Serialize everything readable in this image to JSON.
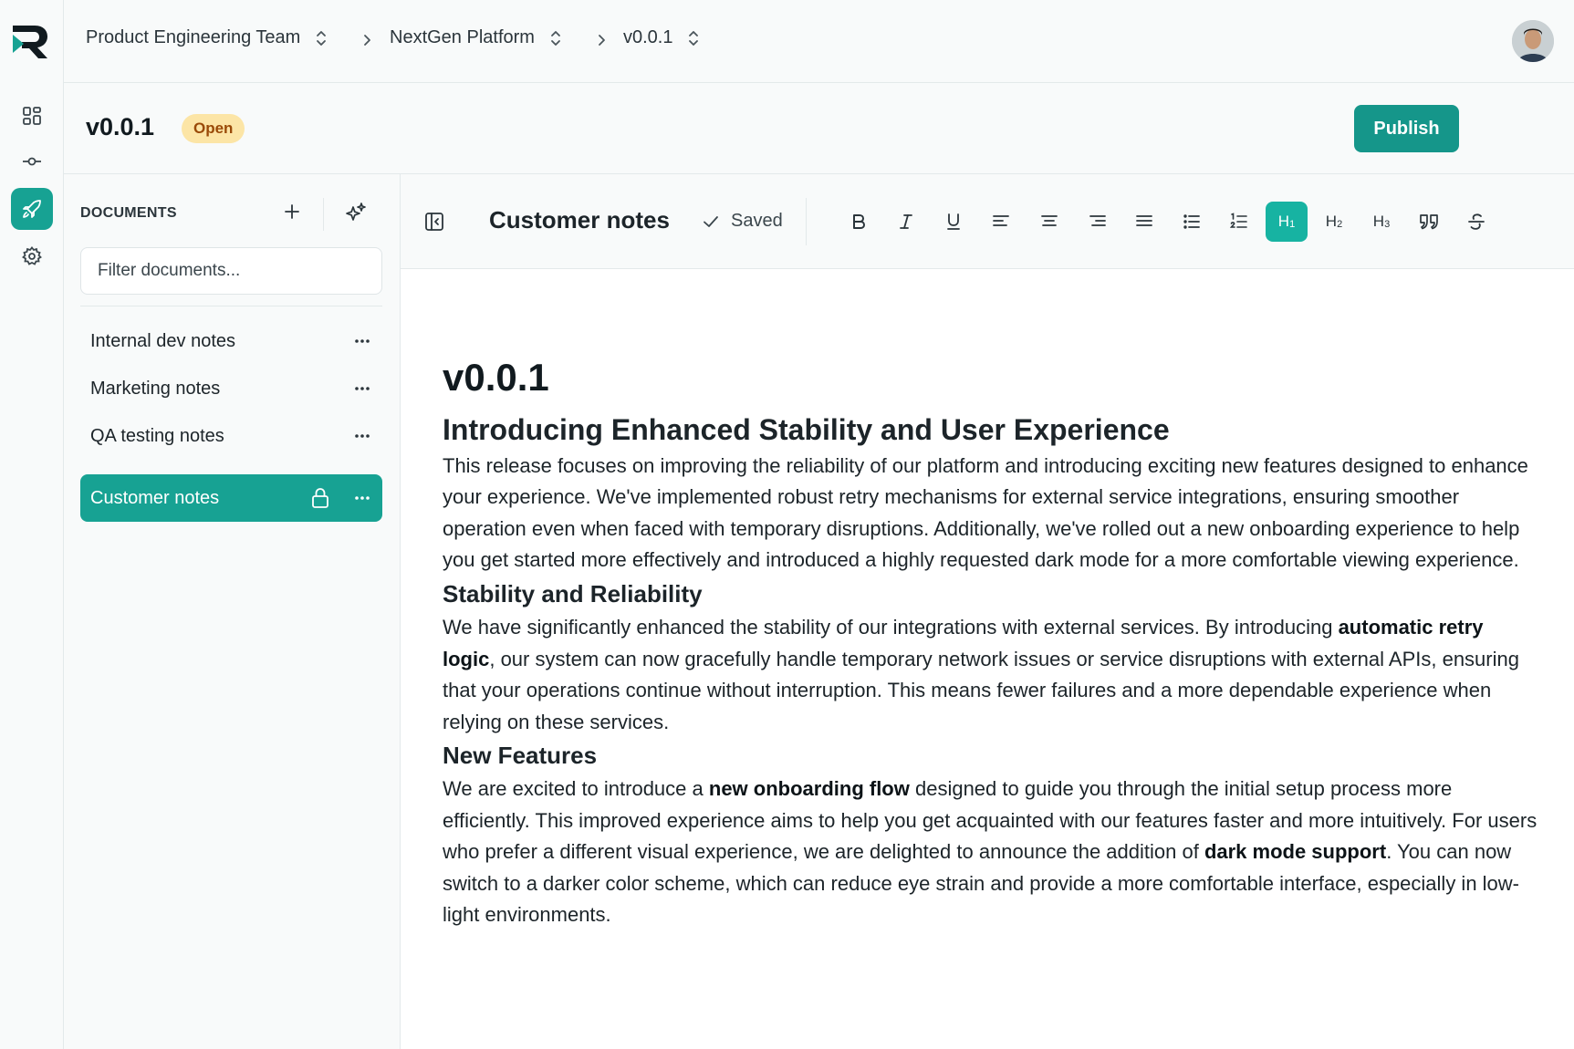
{
  "breadcrumb": {
    "team": "Product Engineering Team",
    "project": "NextGen Platform",
    "version": "v0.0.1"
  },
  "header": {
    "title": "v0.0.1",
    "status": "Open",
    "publish_label": "Publish"
  },
  "documents": {
    "heading": "DOCUMENTS",
    "filter_placeholder": "Filter documents...",
    "items": [
      {
        "label": "Internal dev notes"
      },
      {
        "label": "Marketing notes"
      },
      {
        "label": "QA testing notes"
      },
      {
        "label": "Customer notes"
      }
    ]
  },
  "editor": {
    "title": "Customer notes",
    "saved_label": "Saved",
    "toolbar": {
      "h1": "H",
      "h1_sub": "1",
      "h2": "H",
      "h2_sub": "2",
      "h3": "H",
      "h3_sub": "3"
    },
    "content": {
      "h1": "v0.0.1",
      "h2": "Introducing Enhanced Stability and User Experience",
      "intro": "This release focuses on improving the reliability of our platform and introducing exciting new features designed to enhance your experience. We've implemented robust retry mechanisms for external service integrations, ensuring smoother operation even when faced with temporary disruptions. Additionally, we've rolled out a new onboarding experience to help you get started more effectively and introduced a highly requested dark mode for a more comfortable viewing experience.",
      "s1_heading": "Stability and Reliability",
      "s1_a": "We have significantly enhanced the stability of our integrations with external services. By introducing ",
      "s1_bold": "automatic retry logic",
      "s1_b": ", our system can now gracefully handle temporary network issues or service disruptions with external APIs, ensuring that your operations continue without interruption. This means fewer failures and a more dependable experience when relying on these services.",
      "s2_heading": "New Features",
      "s2_a": "We are excited to introduce a ",
      "s2_bold1": "new onboarding flow",
      "s2_b": " designed to guide you through the initial setup process more efficiently. This improved experience aims to help you get acquainted with our features faster and more intuitively. For users who prefer a different visual experience, we are delighted to announce the addition of ",
      "s2_bold2": "dark mode support",
      "s2_c": ". You can now switch to a darker color scheme, which can reduce eye strain and provide a more comfortable interface, especially in low-light environments."
    }
  },
  "colors": {
    "accent": "#17a293",
    "publish": "#15968a",
    "badge_bg": "#fce5a6",
    "badge_text": "#9a4a08"
  }
}
